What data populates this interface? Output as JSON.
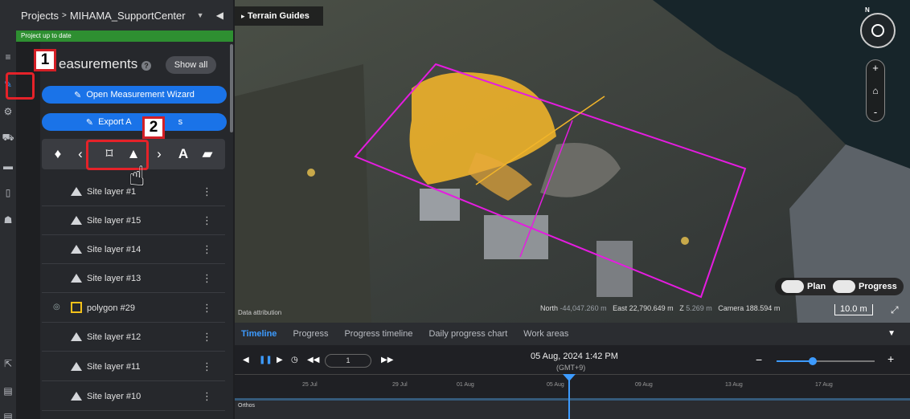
{
  "header": {
    "breadcrumb_root": "Projects",
    "breadcrumb_sep": ">",
    "project_name": "MIHAMA_SupportCenter",
    "status": "Project up to date"
  },
  "panel": {
    "title": "easurements",
    "help": "?",
    "show_all": "Show all",
    "open_wizard": "Open Measurement Wizard",
    "export_label": "Export A",
    "export_tail": "s",
    "tools": [
      "pin-icon",
      "line-icon",
      "polygon-icon",
      "surface-icon",
      "chevron-icon",
      "text-icon",
      "folder-icon"
    ],
    "layers": [
      {
        "name": "Site layer #1",
        "type": "surface"
      },
      {
        "name": "Site layer #15",
        "type": "surface"
      },
      {
        "name": "Site layer #14",
        "type": "surface"
      },
      {
        "name": "Site layer #13",
        "type": "surface"
      },
      {
        "name": "polygon #29",
        "type": "polygon"
      },
      {
        "name": "Site layer #12",
        "type": "surface"
      },
      {
        "name": "Site layer #11",
        "type": "surface"
      },
      {
        "name": "Site layer #10",
        "type": "surface"
      }
    ]
  },
  "callouts": {
    "one": "1",
    "two": "2"
  },
  "map": {
    "title": "Terrain Guides",
    "plan_label": "Plan",
    "progress_label": "Progress",
    "north_label": "North",
    "north_value": "-44,047.260 m",
    "east_label": "East",
    "east_value": "22,790.649 m",
    "z_label": "Z",
    "z_value": "5.269 m",
    "camera_label": "Camera",
    "camera_value": "188.594 m",
    "scale": "10.0 m",
    "attribution": "Data attribution",
    "compass_n": "N"
  },
  "timeline": {
    "tabs": [
      "Timeline",
      "Progress",
      "Progress timeline",
      "Daily progress chart",
      "Work areas"
    ],
    "frame": "1",
    "date": "05 Aug, 2024 1:42 PM",
    "tz": "(GMT+9)",
    "ticks": [
      "25 Jul",
      "29 Jul",
      "01 Aug",
      "05 Aug",
      "09 Aug",
      "13 Aug",
      "17 Aug"
    ],
    "track": "Orthos"
  }
}
